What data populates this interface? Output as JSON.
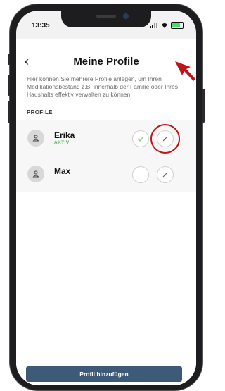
{
  "status_bar": {
    "time": "13:35"
  },
  "header": {
    "back": "‹",
    "title": "Meine Profile"
  },
  "description": "Hier können Sie mehrere Profile anlegen, um Ihren Medikationsbestand z.B. innerhalb der Familie oder Ihres Haushalts effektiv verwalten zu können.",
  "section_label": "PROFILE",
  "profiles": [
    {
      "name": "Erika",
      "badge": "AKTIV",
      "active": true
    },
    {
      "name": "Max",
      "badge": "",
      "active": false
    }
  ],
  "icons": {
    "avatar": "person-icon",
    "check": "checkmark-icon",
    "edit": "pencil-icon"
  },
  "add_button": "Profil hinzufügen",
  "colors": {
    "accent": "#3e5a79",
    "active": "#4cb050",
    "highlight": "#c0131a"
  }
}
